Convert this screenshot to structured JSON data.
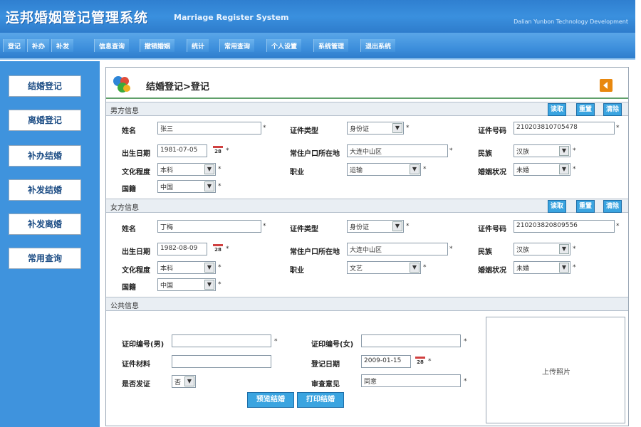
{
  "header": {
    "title": "运邦婚姻登记管理系统",
    "subtitle": "Marriage Register System",
    "company": "Dalian Yunbon Technology Development"
  },
  "menu": [
    "登记",
    "补办",
    "补发",
    "信息查询",
    "撤销婚姻",
    "统计",
    "常用查询",
    "个人设置",
    "系统管理",
    "退出系统"
  ],
  "sidebar": [
    "结婚登记",
    "离婚登记",
    "补办结婚",
    "补发结婚",
    "补发离婚",
    "常用查询"
  ],
  "page": {
    "title": "结婚登记>登记"
  },
  "male": {
    "section": "男方信息",
    "buttons": [
      "读取",
      "重置",
      "清除"
    ],
    "name_label": "姓名",
    "name_value": "张三",
    "cert_type_label": "证件类型",
    "cert_type_value": "身份证",
    "cert_no_label": "证件号码",
    "cert_no_value": "210203810705478",
    "birth_label": "出生日期",
    "birth_value": "1981-07-05",
    "hukou_label": "常住户口所在地",
    "hukou_value": "大连中山区",
    "ethnic_label": "民族",
    "ethnic_value": "汉族",
    "edu_label": "文化程度",
    "edu_value": "本科",
    "job_label": "职业",
    "job_value": "运输",
    "marital_label": "婚姻状况",
    "marital_value": "未婚",
    "nation_label": "国籍",
    "nation_value": "中国"
  },
  "female": {
    "section": "女方信息",
    "buttons": [
      "读取",
      "重置",
      "清除"
    ],
    "name_label": "姓名",
    "name_value": "丁梅",
    "cert_type_label": "证件类型",
    "cert_type_value": "身份证",
    "cert_no_label": "证件号码",
    "cert_no_value": "210203820809556",
    "birth_label": "出生日期",
    "birth_value": "1982-08-09",
    "hukou_label": "常住户口所在地",
    "hukou_value": "大连中山区",
    "ethnic_label": "民族",
    "ethnic_value": "汉族",
    "edu_label": "文化程度",
    "edu_value": "本科",
    "job_label": "职业",
    "job_value": "文艺",
    "marital_label": "婚姻状况",
    "marital_value": "未婚",
    "nation_label": "国籍",
    "nation_value": "中国"
  },
  "common": {
    "section": "公共信息",
    "cert_no_m_label": "证印编号(男)",
    "cert_no_m_value": "",
    "cert_no_f_label": "证印编号(女)",
    "cert_no_f_value": "",
    "material_label": "证件材料",
    "material_value": "",
    "reg_date_label": "登记日期",
    "reg_date_value": "2009-01-15",
    "overseas_label": "是否发证",
    "overseas_value": "否",
    "opinion_label": "审查意见",
    "opinion_value": "同意",
    "photo_label": "上传照片",
    "btn_preview": "预览结婚",
    "btn_print": "打印结婚"
  },
  "calendar_text": "28",
  "required_mark": "*"
}
